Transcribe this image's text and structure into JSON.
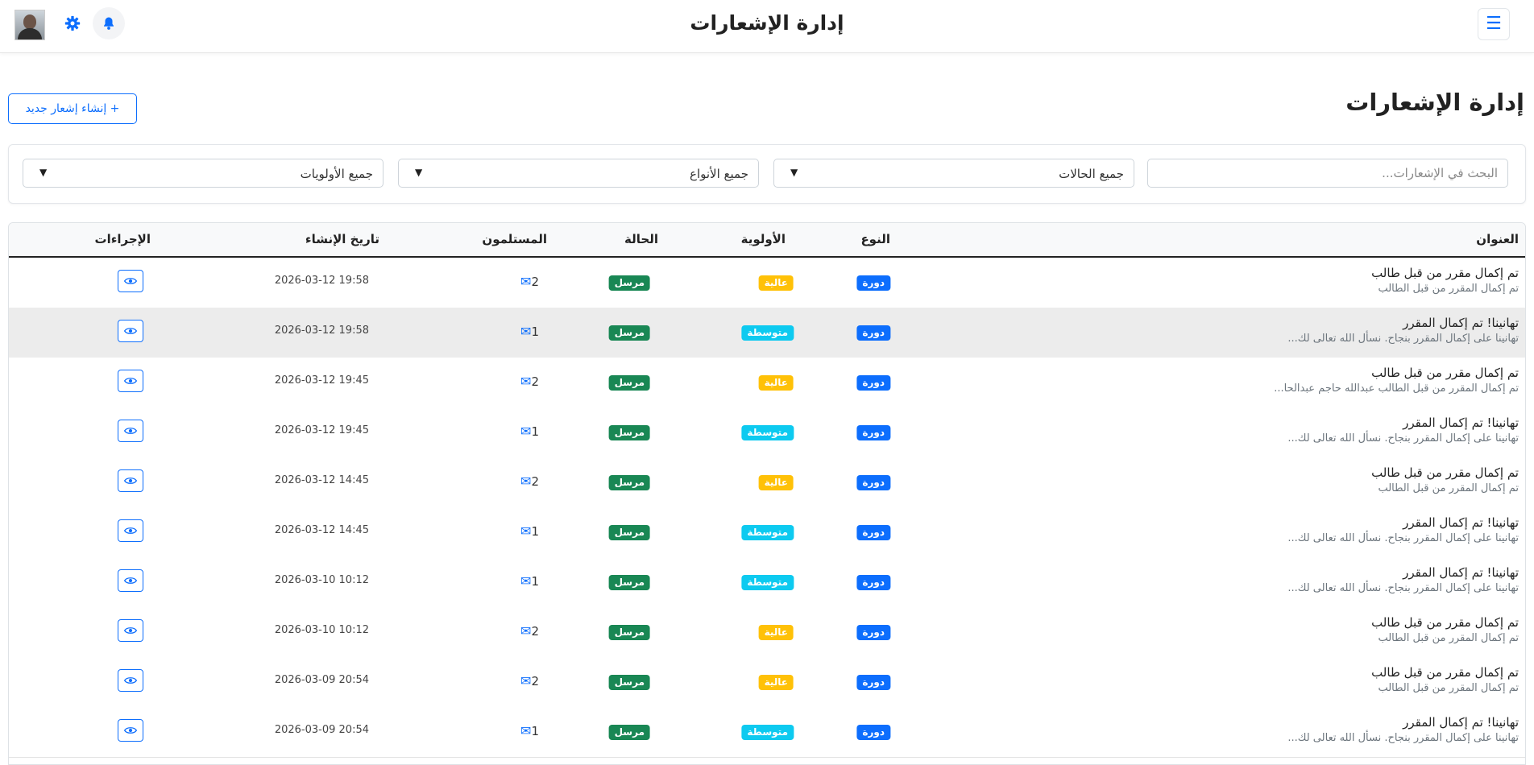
{
  "topbar": {
    "title": "إدارة الإشعارات",
    "menu_icon": "menu-icon",
    "notification_icon": "bell-icon",
    "settings_icon": "gear-icon"
  },
  "page": {
    "title": "إدارة الإشعارات",
    "new_button_label": "+ إنشاء إشعار جديد"
  },
  "filters": {
    "search_placeholder": "البحث في الإشعارات...",
    "status_value": "جميع الحالات",
    "type_value": "جميع الأنواع",
    "priority_value": "جميع الأولويات"
  },
  "table": {
    "headers": {
      "title": "العنوان",
      "type": "النوع",
      "priority": "الأولوية",
      "status": "الحالة",
      "recipients": "المستلمون",
      "created": "تاريخ الإنشاء",
      "actions": "الإجراءات"
    },
    "rows": [
      {
        "title": "تم إكمال مقرر من قبل طالب",
        "desc": "تم إكمال المقرر من قبل الطالب",
        "type": "دورة",
        "priority": "عالية",
        "priority_level": "high",
        "status": "مرسل",
        "recipients": "2",
        "date": "2026-03-12 19:58"
      },
      {
        "title": "تهانينا! تم إكمال المقرر",
        "desc": "تهانينا على إكمال المقرر بنجاح. نسأل الله تعالى لك...",
        "type": "دورة",
        "priority": "متوسطة",
        "priority_level": "medium",
        "status": "مرسل",
        "recipients": "1",
        "date": "2026-03-12 19:58"
      },
      {
        "title": "تم إكمال مقرر من قبل طالب",
        "desc": "تم إكمال المقرر من قبل الطالب عبدالله حاجم عبدالحا...",
        "type": "دورة",
        "priority": "عالية",
        "priority_level": "high",
        "status": "مرسل",
        "recipients": "2",
        "date": "2026-03-12 19:45"
      },
      {
        "title": "تهانينا! تم إكمال المقرر",
        "desc": "تهانينا على إكمال المقرر بنجاح. نسأل الله تعالى لك...",
        "type": "دورة",
        "priority": "متوسطة",
        "priority_level": "medium",
        "status": "مرسل",
        "recipients": "1",
        "date": "2026-03-12 19:45"
      },
      {
        "title": "تم إكمال مقرر من قبل طالب",
        "desc": "تم إكمال المقرر من قبل الطالب",
        "type": "دورة",
        "priority": "عالية",
        "priority_level": "high",
        "status": "مرسل",
        "recipients": "2",
        "date": "2026-03-12 14:45"
      },
      {
        "title": "تهانينا! تم إكمال المقرر",
        "desc": "تهانينا على إكمال المقرر بنجاح. نسأل الله تعالى لك...",
        "type": "دورة",
        "priority": "متوسطة",
        "priority_level": "medium",
        "status": "مرسل",
        "recipients": "1",
        "date": "2026-03-12 14:45"
      },
      {
        "title": "تهانينا! تم إكمال المقرر",
        "desc": "تهانينا على إكمال المقرر بنجاح. نسأل الله تعالى لك...",
        "type": "دورة",
        "priority": "متوسطة",
        "priority_level": "medium",
        "status": "مرسل",
        "recipients": "1",
        "date": "2026-03-10 10:12"
      },
      {
        "title": "تم إكمال مقرر من قبل طالب",
        "desc": "تم إكمال المقرر من قبل الطالب",
        "type": "دورة",
        "priority": "عالية",
        "priority_level": "high",
        "status": "مرسل",
        "recipients": "2",
        "date": "2026-03-10 10:12"
      },
      {
        "title": "تم إكمال مقرر من قبل طالب",
        "desc": "تم إكمال المقرر من قبل الطالب",
        "type": "دورة",
        "priority": "عالية",
        "priority_level": "high",
        "status": "مرسل",
        "recipients": "2",
        "date": "2026-03-09 20:54"
      },
      {
        "title": "تهانينا! تم إكمال المقرر",
        "desc": "تهانينا على إكمال المقرر بنجاح. نسأل الله تعالى لك...",
        "type": "دورة",
        "priority": "متوسطة",
        "priority_level": "medium",
        "status": "مرسل",
        "recipients": "1",
        "date": "2026-03-09 20:54"
      }
    ]
  },
  "colors": {
    "primary": "#0d6efd",
    "success": "#198754",
    "warning": "#ffc107",
    "info": "#0dcaf0"
  }
}
